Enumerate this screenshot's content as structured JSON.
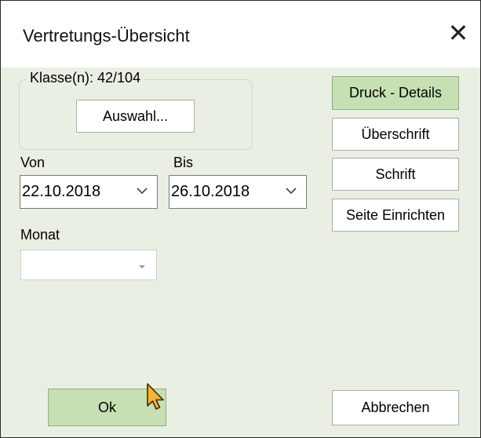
{
  "window": {
    "title": "Vertretungs-Übersicht",
    "close_glyph": "✕"
  },
  "classes_group": {
    "label": "Klasse(n): 42/104",
    "select_button": "Auswahl..."
  },
  "date_range": {
    "from_label": "Von",
    "from_value": "22.10.2018",
    "to_label": "Bis",
    "to_value": "26.10.2018"
  },
  "month": {
    "label": "Monat",
    "value": ""
  },
  "side_buttons": {
    "print_details": "Druck - Details",
    "heading": "Überschrift",
    "font": "Schrift",
    "page_setup": "Seite Einrichten"
  },
  "footer": {
    "ok": "Ok",
    "cancel": "Abbrechen"
  },
  "icons": [
    "close-icon",
    "chevron-down-icon",
    "caret-down-icon",
    "mouse-pointer-icon"
  ],
  "colors": {
    "dialog_bg": "#e9f0e3",
    "accent_button": "#c6e0b4",
    "titlebar": "#ffffff"
  }
}
